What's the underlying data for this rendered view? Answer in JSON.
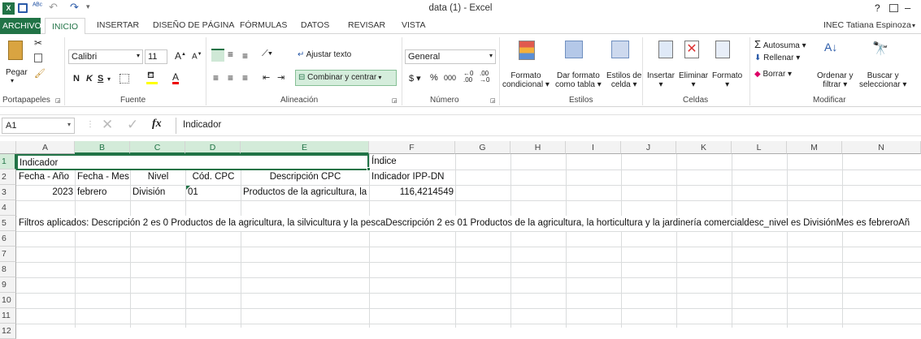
{
  "window": {
    "title": "data (1) - Excel",
    "help": "?",
    "min": "–"
  },
  "tabs": [
    "ARCHIVO",
    "INICIO",
    "INSERTAR",
    "DISEÑO DE PÁGINA",
    "FÓRMULAS",
    "DATOS",
    "REVISAR",
    "VISTA"
  ],
  "user": "INEC Tatiana Espinoza",
  "ribbon": {
    "paste": "Pegar",
    "font_name": "Calibri",
    "font_size": "11",
    "bold": "N",
    "italic": "K",
    "underline": "S",
    "wrap": "Ajustar texto",
    "merge": "Combinar y centrar",
    "numfmt": "General",
    "percent": "%",
    "thousands": "000",
    "cond_fmt": [
      "Formato",
      "condicional"
    ],
    "table_fmt": [
      "Dar formato",
      "como tabla"
    ],
    "cell_styles": [
      "Estilos de",
      "celda"
    ],
    "insert": "Insertar",
    "delete": "Eliminar",
    "format": "Formato",
    "autosum": "Autosuma",
    "fill": "Rellenar",
    "clear": "Borrar",
    "sort": [
      "Ordenar y",
      "filtrar"
    ],
    "find": [
      "Buscar y",
      "seleccionar"
    ]
  },
  "groups": [
    "Portapapeles",
    "Fuente",
    "Alineación",
    "Número",
    "Estilos",
    "Celdas",
    "Modificar"
  ],
  "namebox": "A1",
  "formula": "Indicador",
  "columns": [
    "A",
    "B",
    "C",
    "D",
    "E",
    "F",
    "G",
    "H",
    "I",
    "J",
    "K",
    "L",
    "M",
    "N"
  ],
  "rows": [
    "1",
    "2",
    "3",
    "4",
    "5",
    "6",
    "7",
    "8",
    "9",
    "10",
    "11",
    "12"
  ],
  "cells": {
    "a1": "Indicador",
    "f1": "Índice",
    "a2": "Fecha - Año",
    "b2": "Fecha - Mes",
    "c2": "Nivel",
    "d2": "Cód. CPC",
    "e2": "Descripción CPC",
    "f2": "Indicador IPP-DN",
    "a3": "2023",
    "b3": "febrero",
    "c3": "División",
    "d3": "01",
    "e3": "Productos de la agricultura, la",
    "f3": "116,4214549",
    "a5": "Filtros aplicados: Descripción 2 es 0 Productos de la agricultura, la silvicultura y la pescaDescripción 2 es 01 Productos de la agricultura, la horticultura y la jardinería comercialdesc_nivel es DivisiónMes es febreroAñ"
  }
}
